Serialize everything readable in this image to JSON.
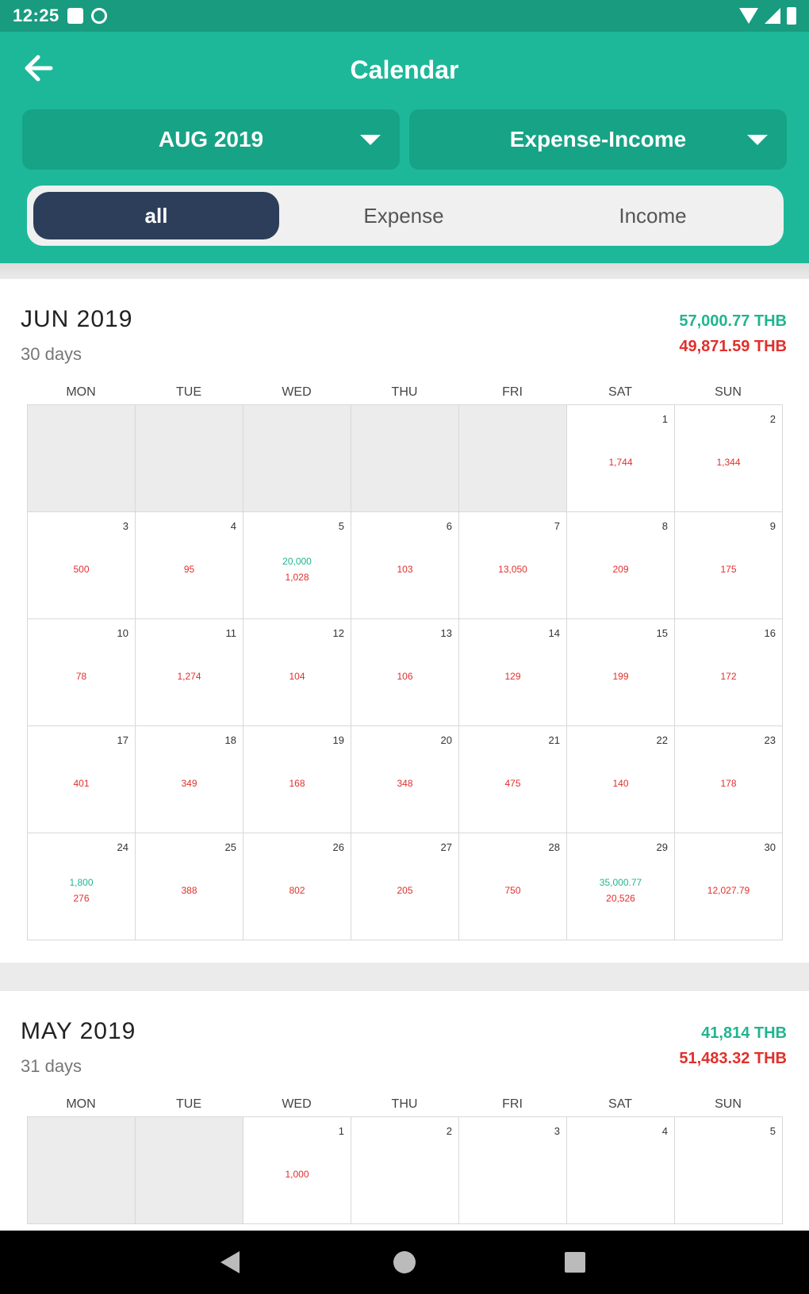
{
  "status": {
    "time": "12:25"
  },
  "appbar": {
    "title": "Calendar",
    "month_select": "AUG 2019",
    "mode_select": "Expense-Income",
    "tabs": [
      {
        "label": "all",
        "active": true
      },
      {
        "label": "Expense",
        "active": false
      },
      {
        "label": "Income",
        "active": false
      }
    ]
  },
  "weekdays": [
    "MON",
    "TUE",
    "WED",
    "THU",
    "FRI",
    "SAT",
    "SUN"
  ],
  "months": [
    {
      "name": "JUN 2019",
      "days_label": "30 days",
      "income_total": "57,000.77 THB",
      "expense_total": "49,871.59 THB",
      "lead_blanks": 5,
      "days": [
        {
          "day": "1",
          "expense": "1,744"
        },
        {
          "day": "2",
          "expense": "1,344"
        },
        {
          "day": "3",
          "expense": "500"
        },
        {
          "day": "4",
          "expense": "95"
        },
        {
          "day": "5",
          "income": "20,000",
          "expense": "1,028"
        },
        {
          "day": "6",
          "expense": "103"
        },
        {
          "day": "7",
          "expense": "13,050"
        },
        {
          "day": "8",
          "expense": "209"
        },
        {
          "day": "9",
          "expense": "175"
        },
        {
          "day": "10",
          "expense": "78"
        },
        {
          "day": "11",
          "expense": "1,274"
        },
        {
          "day": "12",
          "expense": "104"
        },
        {
          "day": "13",
          "expense": "106"
        },
        {
          "day": "14",
          "expense": "129"
        },
        {
          "day": "15",
          "expense": "199"
        },
        {
          "day": "16",
          "expense": "172"
        },
        {
          "day": "17",
          "expense": "401"
        },
        {
          "day": "18",
          "expense": "349"
        },
        {
          "day": "19",
          "expense": "168"
        },
        {
          "day": "20",
          "expense": "348"
        },
        {
          "day": "21",
          "expense": "475"
        },
        {
          "day": "22",
          "expense": "140"
        },
        {
          "day": "23",
          "expense": "178"
        },
        {
          "day": "24",
          "income": "1,800",
          "expense": "276"
        },
        {
          "day": "25",
          "expense": "388"
        },
        {
          "day": "26",
          "expense": "802"
        },
        {
          "day": "27",
          "expense": "205"
        },
        {
          "day": "28",
          "expense": "750"
        },
        {
          "day": "29",
          "income": "35,000.77",
          "expense": "20,526"
        },
        {
          "day": "30",
          "expense": "12,027.79"
        }
      ]
    },
    {
      "name": "MAY 2019",
      "days_label": "31 days",
      "income_total": "41,814 THB",
      "expense_total": "51,483.32 THB",
      "lead_blanks": 2,
      "days": [
        {
          "day": "1",
          "expense": "1,000"
        },
        {
          "day": "2"
        },
        {
          "day": "3"
        },
        {
          "day": "4"
        },
        {
          "day": "5"
        }
      ]
    }
  ]
}
